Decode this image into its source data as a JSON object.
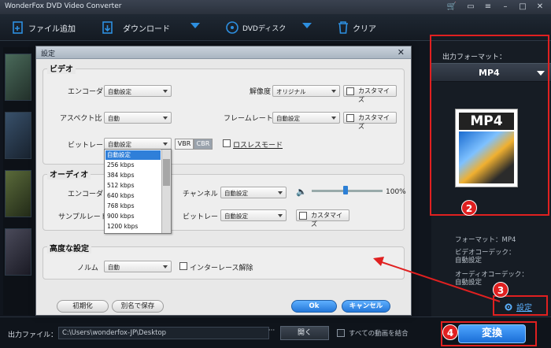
{
  "app": {
    "title": "WonderFox DVD Video Converter"
  },
  "toolbar": {
    "add_files": "ファイル追加",
    "download": "ダウンロード",
    "dvd_disc": "DVDディスク",
    "clear": "クリア"
  },
  "right_panel": {
    "output_format_label": "出力フォーマット：",
    "format_value": "MP4",
    "icon_label": "MP4",
    "info": {
      "format": "フォーマット：MP4",
      "video_codec_label": "ビデオコーデック：",
      "video_codec_value": "自動設定",
      "audio_codec_label": "オーディオコーデック：",
      "audio_codec_value": "自動設定"
    },
    "settings_link": "設定"
  },
  "bottom": {
    "output_file_label": "出力ファイル：",
    "output_path": "C:\\Users\\wonderfox-JP\\Desktop",
    "browse": "···",
    "open": "開く",
    "merge_label": "すべての動画を結合",
    "convert": "変換"
  },
  "annotations": {
    "n2": "2",
    "n3": "3",
    "n4": "4",
    "color": "#e02020"
  },
  "dialog": {
    "title": "設定",
    "close": "✕",
    "video": {
      "section_title": "ビデオ",
      "encoder_label": "エンコーダ",
      "encoder_value": "自動設定",
      "resolution_label": "解像度",
      "resolution_value": "オリジナル",
      "customize_label": "カスタマイズ",
      "aspect_label": "アスペクト比",
      "aspect_value": "自動",
      "framerate_label": "フレームレート",
      "framerate_value": "自動設定",
      "bitrate_label": "ビットレート",
      "bitrate_value": "自動設定",
      "vbr": "VBR",
      "cbr": "CBR",
      "lossless_label": "ロスレスモード",
      "bitrate_options": [
        "自動設定",
        "256 kbps",
        "384 kbps",
        "512 kbps",
        "640 kbps",
        "768 kbps",
        "900 kbps",
        "1200 kbps"
      ]
    },
    "audio": {
      "section_title": "オーディオ",
      "encoder_label": "エンコーダ",
      "channel_label": "チャンネル",
      "channel_value": "自動設定",
      "volume_value": "100%",
      "samplerate_label": "サンプルレート",
      "bitrate_label": "ビットレート",
      "bitrate_value": "自動設定",
      "customize_label": "カスタマイズ"
    },
    "advanced": {
      "section_title": "高度な設定",
      "norm_label": "ノルム",
      "norm_value": "自動",
      "deinterlace_label": "インターレース解除"
    },
    "buttons": {
      "reset": "初期化",
      "save_as": "別名で保存",
      "ok": "Ok",
      "cancel": "キャンセル"
    }
  }
}
